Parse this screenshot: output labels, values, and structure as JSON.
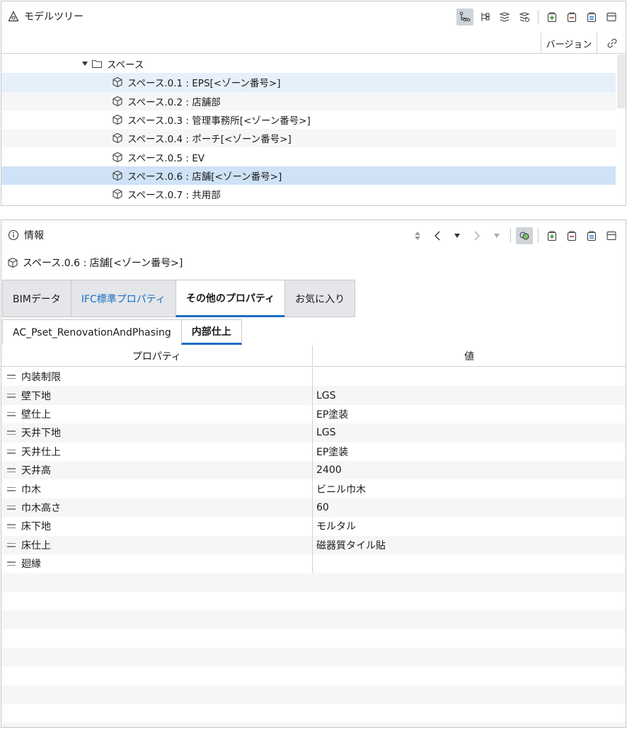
{
  "model_tree": {
    "title": "モデルツリー",
    "version_col": "バージョン",
    "folder": "スペース",
    "items": [
      {
        "label": "スペース.0.1 : EPS[<ゾーン番号>]"
      },
      {
        "label": "スペース.0.2 : 店舗部"
      },
      {
        "label": "スペース.0.3 : 管理事務所[<ゾーン番号>]"
      },
      {
        "label": "スペース.0.4 : ポーチ[<ゾーン番号>]"
      },
      {
        "label": "スペース.0.5 : EV"
      },
      {
        "label": "スペース.0.6 : 店舗[<ゾーン番号>]"
      },
      {
        "label": "スペース.0.7 : 共用部"
      }
    ]
  },
  "info": {
    "title": "情報",
    "selected_object": "スペース.0.6 : 店舗[<ゾーン番号>]",
    "tabs": [
      "BIMデータ",
      "IFC標準プロパティ",
      "その他のプロパティ",
      "お気に入り"
    ],
    "subtabs": [
      "AC_Pset_RenovationAndPhasing",
      "内部仕上"
    ],
    "columns": {
      "property": "プロパティ",
      "value": "値"
    },
    "rows": [
      {
        "name": "内装制限",
        "value": ""
      },
      {
        "name": "壁下地",
        "value": "LGS"
      },
      {
        "name": "壁仕上",
        "value": "EP塗装"
      },
      {
        "name": "天井下地",
        "value": "LGS"
      },
      {
        "name": "天井仕上",
        "value": "EP塗装"
      },
      {
        "name": "天井高",
        "value": "2400"
      },
      {
        "name": "巾木",
        "value": "ビニル巾木"
      },
      {
        "name": "巾木高さ",
        "value": "60"
      },
      {
        "name": "床下地",
        "value": "モルタル"
      },
      {
        "name": "床仕上",
        "value": "磁器質タイル貼"
      },
      {
        "name": "廻縁",
        "value": ""
      }
    ]
  },
  "colors": {
    "accent": "#1a6fc7",
    "selection": "#cfe2f6",
    "hover": "#e6f0fb",
    "tab_bg": "#e4e6e9"
  }
}
